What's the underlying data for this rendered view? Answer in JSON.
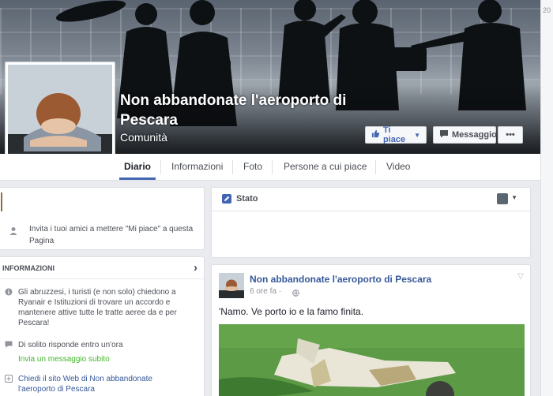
{
  "page": {
    "name": "Non abbandonate l'aeroporto di Pescara",
    "category": "Comunità"
  },
  "cover_buttons": {
    "like": "Ti piace",
    "message": "Messaggio",
    "more": "•••"
  },
  "tabs": [
    {
      "label": "Diario",
      "active": true
    },
    {
      "label": "Informazioni",
      "active": false
    },
    {
      "label": "Foto",
      "active": false
    },
    {
      "label": "Persone a cui piace",
      "active": false
    },
    {
      "label": "Video",
      "active": false
    }
  ],
  "invite": {
    "text": "Invita i tuoi amici a mettere \"Mi piace\" a questa Pagina"
  },
  "info": {
    "heading": "INFORMAZIONI",
    "description": "Gli abruzzesi, i turisti (e non solo) chiedono a Ryanair e Istituzioni di trovare un accordo e mantenere attive tutte le tratte aeree da e per Pescara!",
    "response": "Di solito risponde entro un'ora",
    "send_message": "Invia un messaggio subito",
    "website_link": "Chiedi il sito Web di Non abbandonate l'aeroporto di Pescara"
  },
  "composer": {
    "status_label": "Stato"
  },
  "post": {
    "author": "Non abbandonate l'aeroporto di Pescara",
    "time": "6 ore fa ·",
    "text": "'Namo. Ve porto io e la famo finita."
  },
  "right_strip": {
    "text": "20"
  },
  "colors": {
    "brand_blue": "#4267b2",
    "link_blue": "#365899",
    "green_link": "#42b72a",
    "background": "#e9ebee"
  },
  "icons": {
    "like": "thumbs-up-icon",
    "message": "chat-bubble-icon",
    "status": "pencil-icon",
    "invite": "person-icon",
    "info": "info-icon",
    "response": "chat-bubble-icon",
    "website": "globe-icon",
    "privacy": "globe-icon"
  }
}
